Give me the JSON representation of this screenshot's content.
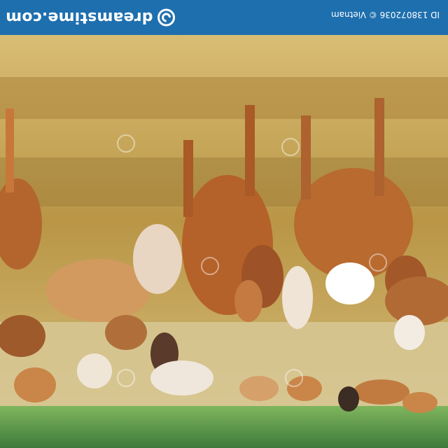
{
  "header": {
    "brand_text": "dreamstime.com",
    "credit_text": "ID 138072036 © Vietnam",
    "logo_icon": "spiral-logo-icon"
  },
  "colors": {
    "header_bg": "#1e6fae",
    "straw": "#c9a75a",
    "grass": "#5f9b4b"
  }
}
